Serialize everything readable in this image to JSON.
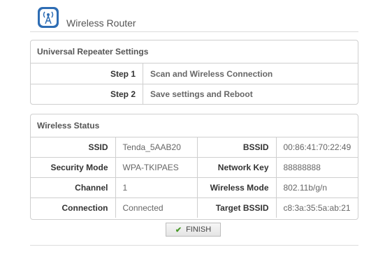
{
  "header": {
    "title": "Wireless Router",
    "logo_icon": "router-antenna-icon"
  },
  "repeater": {
    "title": "Universal Repeater Settings",
    "steps": [
      {
        "label": "Step 1",
        "description": "Scan and Wireless Connection"
      },
      {
        "label": "Step 2",
        "description": "Save settings and Reboot"
      }
    ]
  },
  "status": {
    "title": "Wireless Status",
    "rows": [
      {
        "label1": "SSID",
        "value1": "Tenda_5AAB20",
        "label2": "BSSID",
        "value2": "00:86:41:70:22:49"
      },
      {
        "label1": "Security Mode",
        "value1": "WPA-TKIPAES",
        "label2": "Network Key",
        "value2": "88888888"
      },
      {
        "label1": "Channel",
        "value1": "1",
        "label2": "Wireless Mode",
        "value2": "802.11b/g/n"
      },
      {
        "label1": "Connection",
        "value1": "Connected",
        "label2": "Target BSSID",
        "value2": "c8:3a:35:5a:ab:21"
      }
    ]
  },
  "actions": {
    "finish_label": "FINISH",
    "finish_icon": "checkmark-icon"
  },
  "colors": {
    "accent_blue": "#2e6db4",
    "check_green": "#4a9a2a",
    "border": "#cfcfcf"
  }
}
